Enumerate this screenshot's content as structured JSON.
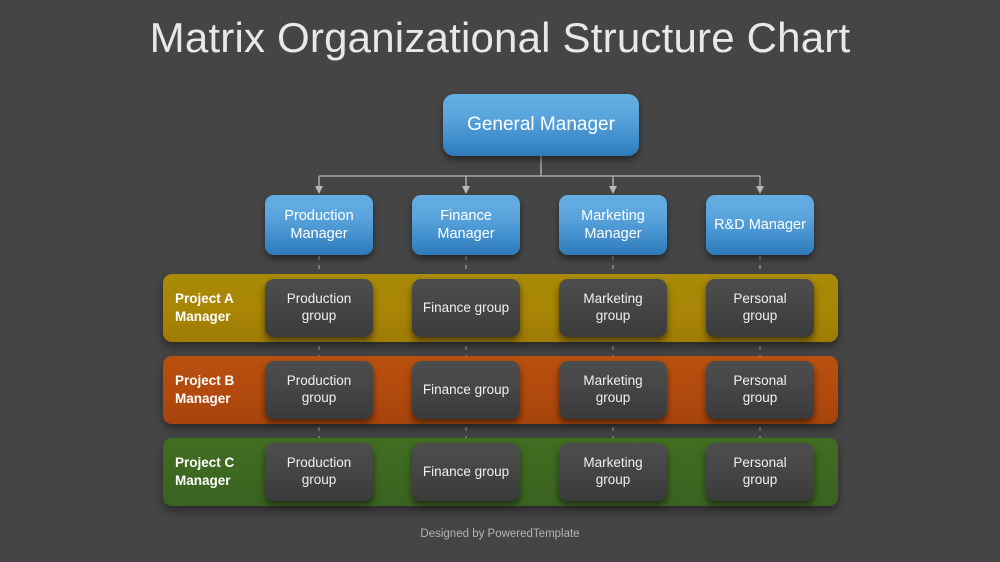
{
  "title": "Matrix Organizational Structure Chart",
  "footer": "Designed by PoweredTemplate",
  "top": {
    "general_manager": "General Manager"
  },
  "managers": [
    {
      "line1": "Production",
      "line2": "Manager",
      "full": "Production Manager"
    },
    {
      "line1": "Finance",
      "line2": "Manager",
      "full": "Finance Manager"
    },
    {
      "line1": "Marketing",
      "line2": "Manager",
      "full": "Marketing Manager"
    },
    {
      "line1": "R&D Manager",
      "line2": "",
      "full": "R&D Manager"
    }
  ],
  "projects": [
    {
      "label_line1": "Project A",
      "label_line2": "Manager",
      "label_full": "Project A Manager",
      "color": "#a98a06",
      "groups": [
        {
          "line1": "Production",
          "line2": "group",
          "full": "Production group"
        },
        {
          "line1": "Finance group",
          "line2": "",
          "full": "Finance group"
        },
        {
          "line1": "Marketing",
          "line2": "group",
          "full": "Marketing group"
        },
        {
          "line1": "Personal",
          "line2": "group",
          "full": "Personal group"
        }
      ]
    },
    {
      "label_line1": "Project B",
      "label_line2": "Manager",
      "label_full": "Project B Manager",
      "color": "#b9500f",
      "groups": [
        {
          "line1": "Production",
          "line2": "group",
          "full": "Production group"
        },
        {
          "line1": "Finance group",
          "line2": "",
          "full": "Finance group"
        },
        {
          "line1": "Marketing",
          "line2": "group",
          "full": "Marketing group"
        },
        {
          "line1": "Personal",
          "line2": "group",
          "full": "Personal group"
        }
      ]
    },
    {
      "label_line1": "Project C",
      "label_line2": "Manager",
      "label_full": "Project C Manager",
      "color": "#416e21",
      "groups": [
        {
          "line1": "Production",
          "line2": "group",
          "full": "Production group"
        },
        {
          "line1": "Finance group",
          "line2": "",
          "full": "Finance group"
        },
        {
          "line1": "Marketing",
          "line2": "group",
          "full": "Marketing group"
        },
        {
          "line1": "Personal",
          "line2": "group",
          "full": "Personal group"
        }
      ]
    }
  ],
  "colors": {
    "background": "#454545",
    "blue_box_top": "#64aee2",
    "blue_box_bottom": "#2e7ab9",
    "group_box": "#474747",
    "connector_line": "#b8b8b8",
    "title_text": "#e8e8e8",
    "footer_text": "#b4b4b4"
  }
}
